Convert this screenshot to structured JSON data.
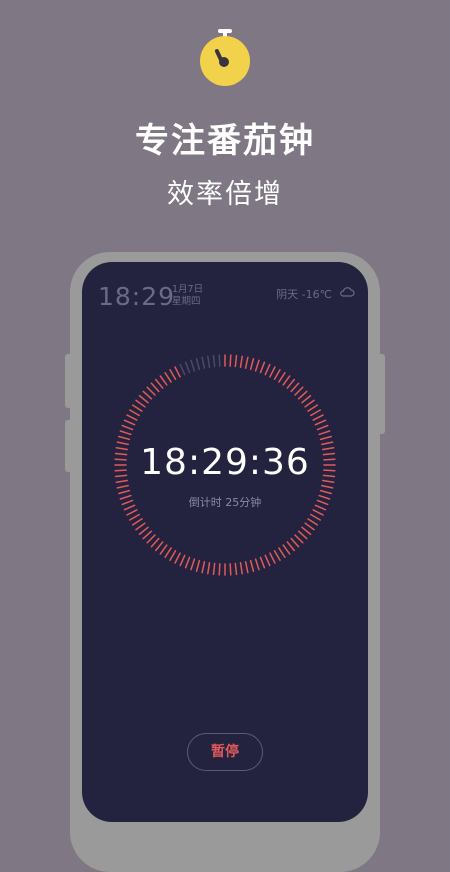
{
  "colors": {
    "background": "#7f7884",
    "icon_yellow": "#f2d24a",
    "screen": "#24233f",
    "accent_red": "#e05a5a",
    "tick_inactive": "#4a4a66"
  },
  "app_icon": {
    "icon": "stopwatch-icon"
  },
  "headline": "专注番茄钟",
  "subheadline": "效率倍增",
  "status_bar": {
    "time": "18:29",
    "date": "1月7日",
    "weekday": "星期四",
    "weather": "阴天 -16℃",
    "weather_icon": "cloud-icon"
  },
  "timer": {
    "display": "18:29:36",
    "caption": "倒计时 25分钟",
    "progress": 0.93
  },
  "pause_button": "暂停"
}
